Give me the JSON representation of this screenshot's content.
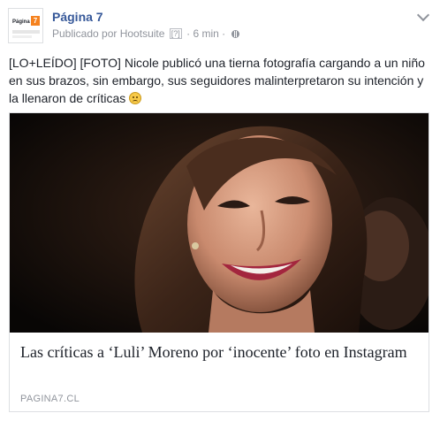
{
  "header": {
    "page_name": "Página 7",
    "published_by": "Publicado por Hootsuite",
    "hootsuite_badge": "[?]",
    "separator": "·",
    "time": "6 min",
    "separator2": "·",
    "avatar_logo_text": "Página",
    "avatar_logo_number": "7"
  },
  "post": {
    "message": "[LO+LEÍDO] [FOTO] Nicole publicó una tierna fotografía cargando a un niño en sus brazos, sin embargo, sus seguidores malinterpretaron su intención y la llenaron de críticas"
  },
  "link_card": {
    "title": "Las críticas a ‘Luli’ Moreno por ‘inocente’ foto en Instagram",
    "domain": "PAGINA7.CL"
  },
  "icons": {
    "globe": "globe-icon",
    "menu": "chevron-down-icon",
    "emoji": "frowning-face-emoji"
  },
  "colors": {
    "link_blue": "#365899",
    "meta_gray": "#90949c",
    "border": "#dddfe2"
  }
}
